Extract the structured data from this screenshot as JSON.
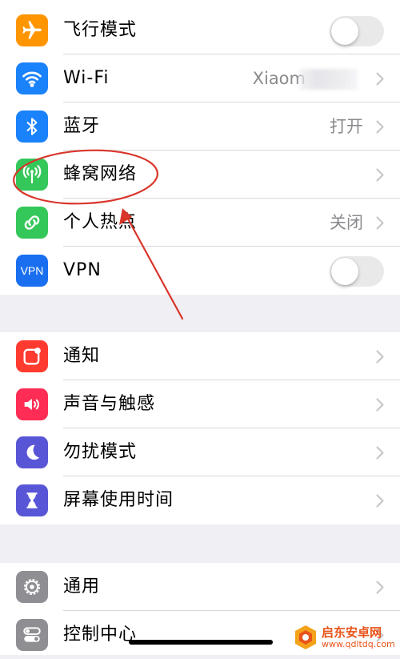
{
  "colors": {
    "airplane": "#ff9500",
    "wifi": "#1a82fb",
    "bluetooth": "#1a82fb",
    "cellular": "#34c759",
    "hotspot": "#34c759",
    "vpn": "#1a6ff0",
    "notifications": "#ff3b30",
    "sounds": "#ff2d55",
    "dnd": "#5856d6",
    "screen_time": "#5856d6",
    "general": "#8e8e93",
    "control_center": "#8e8e93",
    "annotation": "#d9352b"
  },
  "group1": {
    "airplane_mode": {
      "label": "飞行模式",
      "icon": "airplane-icon",
      "toggle_on": false
    },
    "wifi": {
      "label": "Wi-Fi",
      "value": "Xiaom",
      "icon": "wifi-icon"
    },
    "bluetooth": {
      "label": "蓝牙",
      "value": "打开",
      "icon": "bluetooth-icon"
    },
    "cellular": {
      "label": "蜂窝网络",
      "icon": "antenna-icon"
    },
    "hotspot": {
      "label": "个人热点",
      "value": "关闭",
      "icon": "link-icon"
    },
    "vpn": {
      "label": "VPN",
      "icon_text": "VPN",
      "toggle_on": false
    }
  },
  "group2": {
    "notifications": {
      "label": "通知",
      "icon": "notification-icon"
    },
    "sounds": {
      "label": "声音与触感",
      "icon": "speaker-icon"
    },
    "dnd": {
      "label": "勿扰模式",
      "icon": "moon-icon"
    },
    "screen_time": {
      "label": "屏幕使用时间",
      "icon": "hourglass-icon"
    }
  },
  "group3": {
    "general": {
      "label": "通用",
      "icon": "gear-icon"
    },
    "control_center": {
      "label": "控制中心",
      "icon": "switches-icon"
    }
  },
  "watermark": {
    "line1": "启东安卓网",
    "line2": "www.qdltdq.com"
  }
}
